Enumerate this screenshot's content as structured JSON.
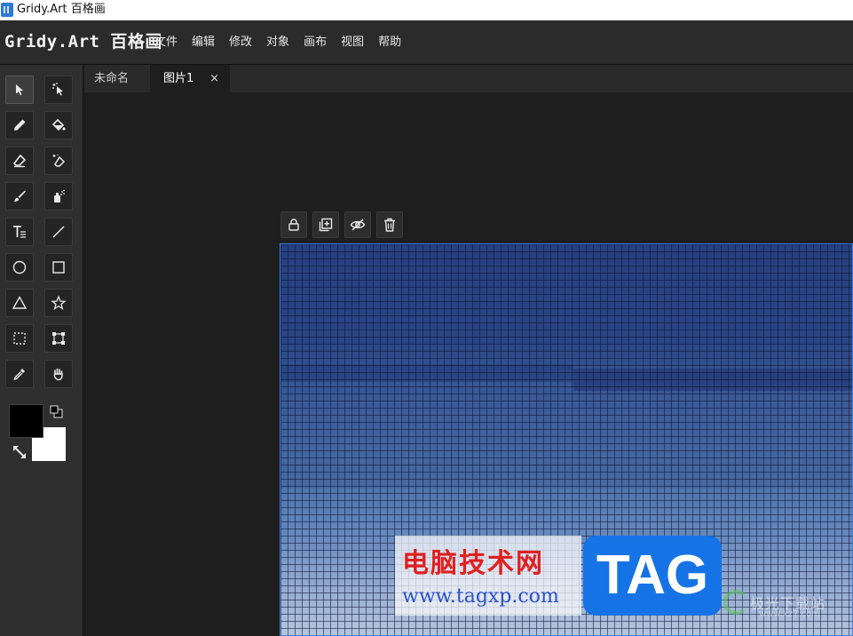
{
  "window": {
    "title": "Gridy.Art 百格画"
  },
  "menubar": {
    "logo": "Gridy.Art 百格画",
    "items": [
      "文件",
      "编辑",
      "修改",
      "对象",
      "画布",
      "视图",
      "帮助"
    ]
  },
  "tools": [
    {
      "name": "select",
      "icon": "cursor-arrow-icon",
      "active": true
    },
    {
      "name": "magic-select",
      "icon": "magic-cursor-icon"
    },
    {
      "name": "pencil",
      "icon": "pencil-icon"
    },
    {
      "name": "fill",
      "icon": "paint-bucket-icon"
    },
    {
      "name": "eraser",
      "icon": "eraser-icon"
    },
    {
      "name": "magic-eraser",
      "icon": "magic-eraser-icon"
    },
    {
      "name": "brush",
      "icon": "brush-icon"
    },
    {
      "name": "spray",
      "icon": "spray-can-icon"
    },
    {
      "name": "text",
      "icon": "text-icon"
    },
    {
      "name": "line",
      "icon": "line-icon"
    },
    {
      "name": "ellipse",
      "icon": "circle-icon"
    },
    {
      "name": "rectangle",
      "icon": "square-icon"
    },
    {
      "name": "triangle",
      "icon": "triangle-icon"
    },
    {
      "name": "star",
      "icon": "star-icon"
    },
    {
      "name": "marquee",
      "icon": "dashed-rect-icon"
    },
    {
      "name": "transform",
      "icon": "transform-icon"
    },
    {
      "name": "eyedropper",
      "icon": "eyedropper-icon"
    },
    {
      "name": "hand",
      "icon": "hand-icon"
    }
  ],
  "colors": {
    "foreground": "#000000",
    "background": "#ffffff",
    "accent": "#3d7fe0"
  },
  "tabs": [
    {
      "label": "未命名",
      "active": false
    },
    {
      "label": "图片1",
      "active": true,
      "close": "×"
    }
  ],
  "layer_actions": [
    "lock-icon",
    "duplicate-icon",
    "hide-eye-icon",
    "trash-icon"
  ],
  "watermark": {
    "cn": "电脑技术网",
    "url": "www.tagxp.com",
    "tag": "TAG",
    "site2": "极光下载站",
    "site2_sub": "www.xz7.com"
  }
}
